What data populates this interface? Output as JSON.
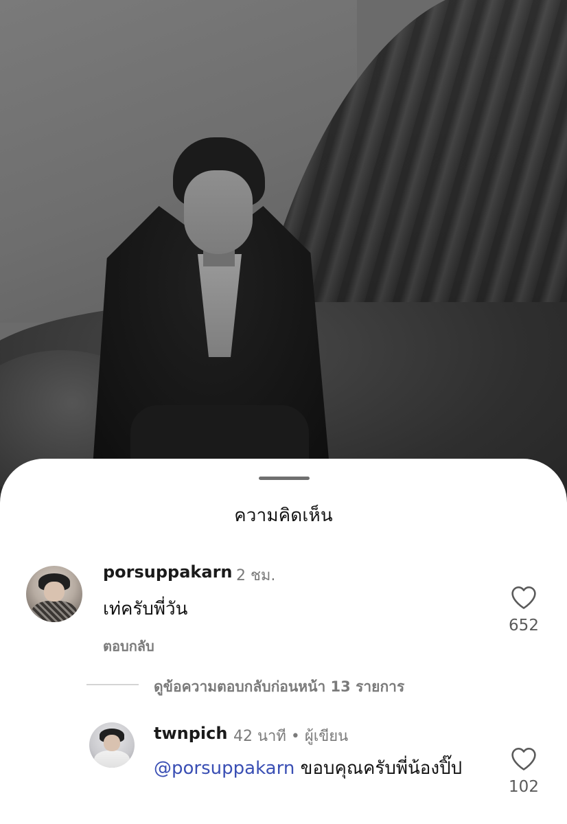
{
  "sheet": {
    "title": "ความคิดเห็น"
  },
  "comments": [
    {
      "username": "porsuppakarn",
      "time": "2 ชม.",
      "text": "เท่ครับพี่วัน",
      "reply_label": "ตอบกลับ",
      "likes": "652"
    },
    {
      "username": "twnpich",
      "time": "42 นาที • ผู้เขียน",
      "mention": "@porsuppakarn",
      "text": " ขอบคุณครับพี่น้องปิ๊ป",
      "likes": "102"
    }
  ],
  "thread": {
    "view_previous_replies": "ดูข้อความตอบกลับก่อนหน้า 13 รายการ"
  },
  "icons": {
    "like": "heart-outline-icon"
  }
}
